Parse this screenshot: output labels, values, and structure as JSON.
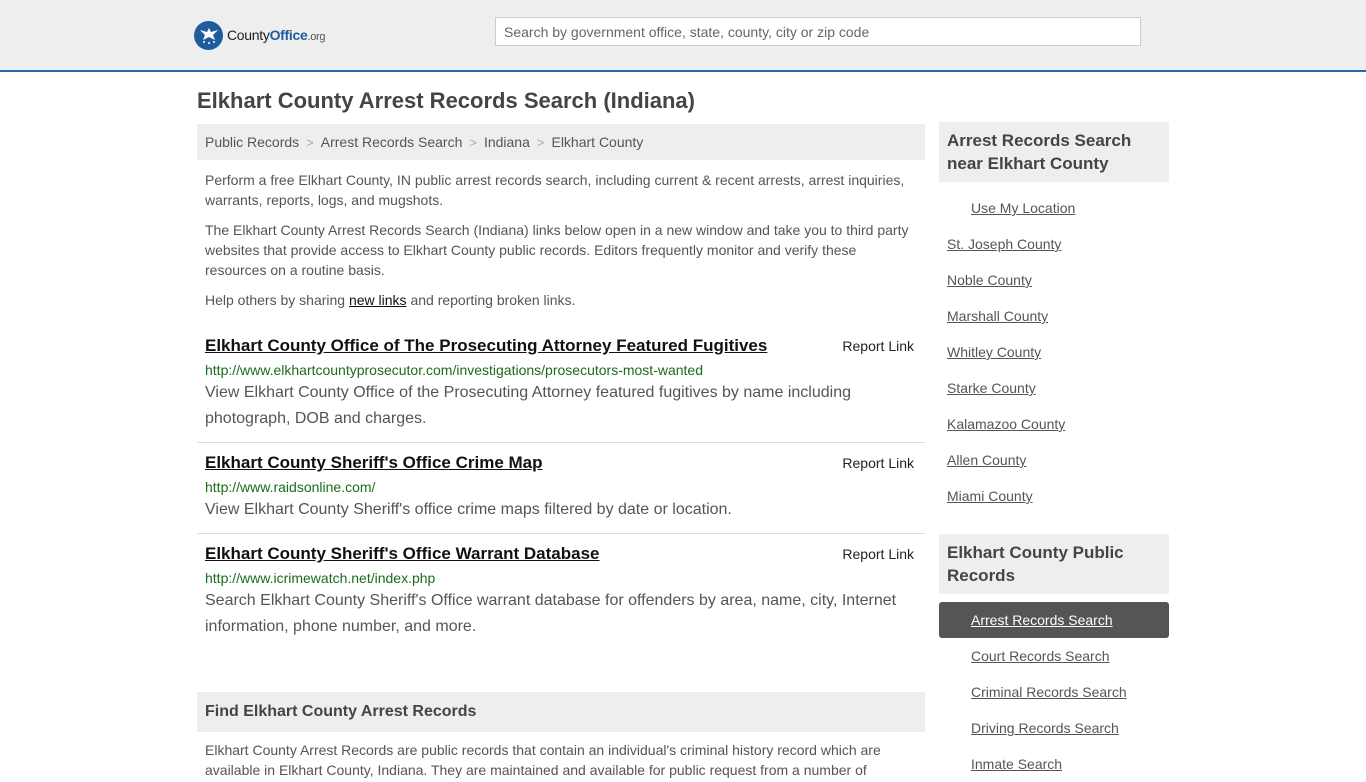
{
  "header": {
    "logo": {
      "prefix": "County",
      "brand": "Office",
      "suffix": ".org"
    },
    "search": {
      "placeholder": "Search by government office, state, county, city or zip code",
      "value": ""
    }
  },
  "page_title": "Elkhart County Arrest Records Search (Indiana)",
  "breadcrumb": [
    "Public Records",
    "Arrest Records Search",
    "Indiana",
    "Elkhart County"
  ],
  "intro": {
    "p1": "Perform a free Elkhart County, IN public arrest records search, including current & recent arrests, arrest inquiries, warrants, reports, logs, and mugshots.",
    "p2": "The Elkhart County Arrest Records Search (Indiana) links below open in a new window and take you to third party websites that provide access to Elkhart County public records. Editors frequently monitor and verify these resources on a routine basis.",
    "p3_before": "Help others by sharing ",
    "p3_link": "new links",
    "p3_after": " and reporting broken links."
  },
  "report_label": "Report Link",
  "listings": [
    {
      "title": "Elkhart County Office of The Prosecuting Attorney Featured Fugitives",
      "url": "http://www.elkhartcountyprosecutor.com/investigations/prosecutors-most-wanted",
      "description": "View Elkhart County Office of the Prosecuting Attorney featured fugitives by name including photograph, DOB and charges."
    },
    {
      "title": "Elkhart County Sheriff's Office Crime Map",
      "url": "http://www.raidsonline.com/",
      "description": "View Elkhart County Sheriff's office crime maps filtered by date or location."
    },
    {
      "title": "Elkhart County Sheriff's Office Warrant Database",
      "url": "http://www.icrimewatch.net/index.php",
      "description": "Search Elkhart County Sheriff's Office warrant database for offenders by area, name, city, Internet information, phone number, and more."
    }
  ],
  "find_section": {
    "heading": "Find Elkhart County Arrest Records",
    "text": "Elkhart County Arrest Records are public records that contain an individual's criminal history record which are available in Elkhart County, Indiana. They are maintained and available for public request from a number of"
  },
  "sidebar": {
    "nearby_heading": "Arrest Records Search near Elkhart County",
    "use_location": "Use My Location",
    "nearby": [
      "St. Joseph County",
      "Noble County",
      "Marshall County",
      "Whitley County",
      "Starke County",
      "Kalamazoo County",
      "Allen County",
      "Miami County"
    ],
    "public_heading": "Elkhart County Public Records",
    "public_records": [
      "Arrest Records Search",
      "Court Records Search",
      "Criminal Records Search",
      "Driving Records Search",
      "Inmate Search"
    ],
    "active_index": 0
  }
}
